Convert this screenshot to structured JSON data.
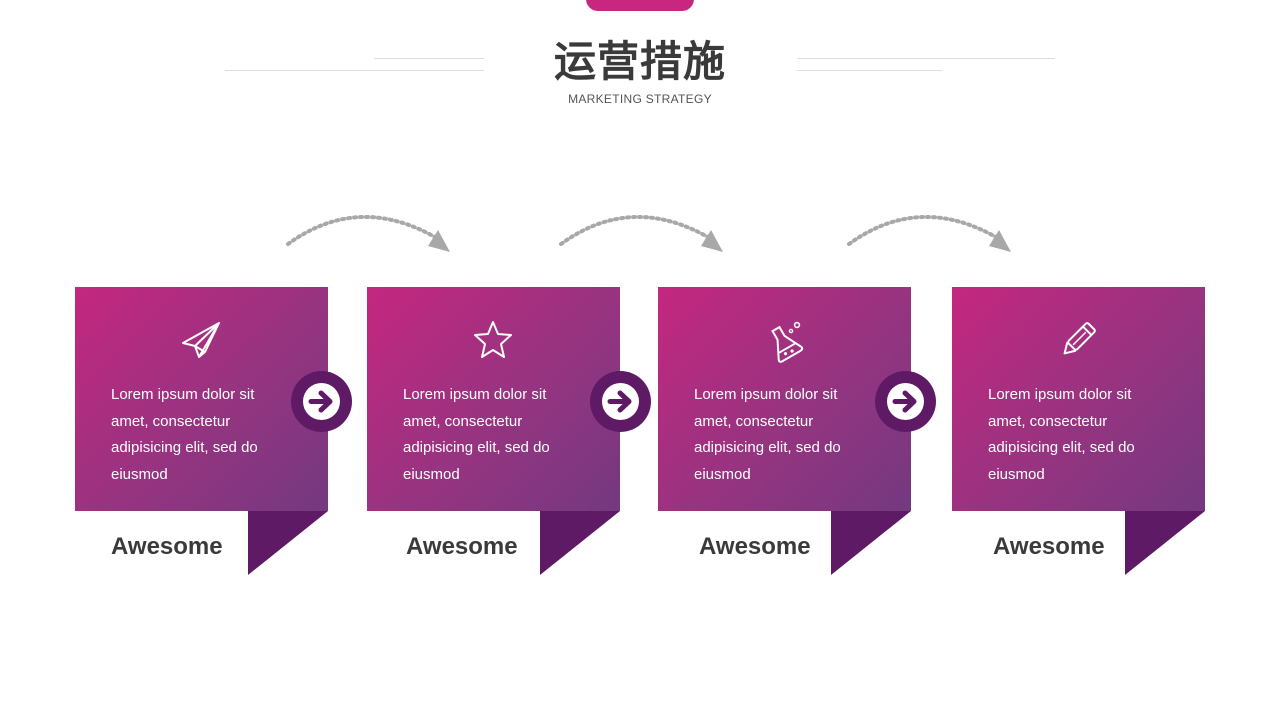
{
  "header": {
    "title": "运营措施",
    "subtitle": "MARKETING  STRATEGY"
  },
  "colors": {
    "accent": "#c8267f",
    "gradient_start": "#c4277f",
    "gradient_end": "#73397f",
    "dark_purple": "#5e1a65",
    "label_text": "#3a3a3a",
    "arc_dots": "#a8a8a8"
  },
  "steps": [
    {
      "icon": "paper-plane-icon",
      "text": "Lorem ipsum dolor sit amet, consectetur adipisicing elit, sed do eiusmod",
      "label": "Awesome"
    },
    {
      "icon": "star-icon",
      "text": "Lorem ipsum dolor sit amet, consectetur adipisicing elit, sed do eiusmod",
      "label": "Awesome"
    },
    {
      "icon": "flask-icon",
      "text": "Lorem ipsum dolor sit amet, consectetur adipisicing elit, sed do eiusmod",
      "label": "Awesome"
    },
    {
      "icon": "pencil-icon",
      "text": "Lorem ipsum dolor sit amet, consectetur adipisicing elit, sed do eiusmod",
      "label": "Awesome"
    }
  ],
  "connectors": [
    {
      "icon": "arrow-right-circle-icon"
    },
    {
      "icon": "arrow-right-circle-icon"
    },
    {
      "icon": "arrow-right-circle-icon"
    }
  ]
}
